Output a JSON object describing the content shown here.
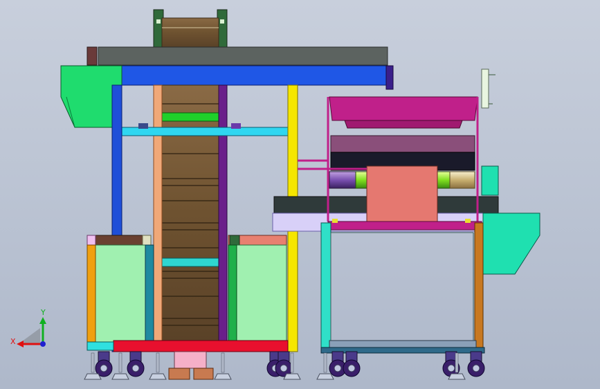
{
  "viewport": {
    "background_top": "#c8cfdc",
    "background_bottom": "#aeb8ca"
  },
  "machine": {
    "description_colors": {
      "frame_blue": "#1f4fd8",
      "top_beam_blue": "#1f57e6",
      "cyan_rail": "#2fd6f0",
      "yellow_post": "#f5e600",
      "salmon_post": "#f0a878",
      "purple_post": "#6a1f8a",
      "belt_brown": "#7a5b35",
      "green_hopper": "#1fdc6e",
      "panel_green": "#a0f0b0",
      "red_base": "#e8102e",
      "teal_post": "#1f8aa0",
      "magenta_frame": "#c0208a",
      "pink_block": "#e57870",
      "mauve": "#8a4f7a",
      "orange_post": "#c87820",
      "gray_bar": "#5c6360",
      "mint_hopper": "#1fe0b0",
      "caster_purple": "#3a1f6a"
    }
  },
  "axis_triad": {
    "x_label": "X",
    "y_label": "Y",
    "x_color": "#e01010",
    "y_color": "#10b020",
    "z_color": "#2020d0"
  }
}
